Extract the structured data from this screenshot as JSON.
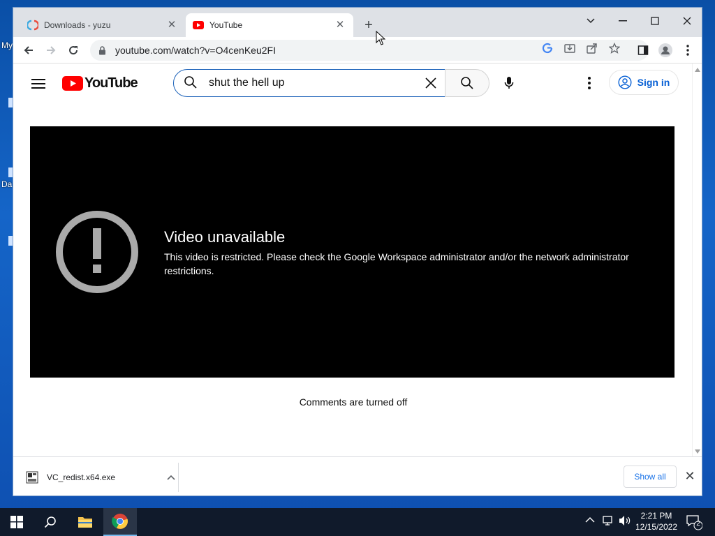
{
  "desktop": {
    "fragment_top": "My",
    "fragment_mid": "Da"
  },
  "tabs": [
    {
      "title": "Downloads - yuzu",
      "favicon": "yuzu-logo-icon",
      "active": false
    },
    {
      "title": "YouTube",
      "favicon": "youtube-icon",
      "active": true
    }
  ],
  "tab_close_glyph": "✕",
  "new_tab_glyph": "+",
  "address_bar": {
    "url": "youtube.com/watch?v=O4cenKeu2FI"
  },
  "youtube": {
    "logo_text": "YouTube",
    "search_query": "shut the hell up",
    "sign_in_label": "Sign in",
    "error_title": "Video unavailable",
    "error_message": "This video is restricted. Please check the Google Workspace administrator and/or the network administrator restrictions.",
    "comments_status": "Comments are turned off"
  },
  "downloads_bar": {
    "file_name": "VC_redist.x64.exe",
    "show_all_label": "Show all",
    "close_glyph": "✕"
  },
  "taskbar": {
    "time": "2:21 PM",
    "date": "12/15/2022",
    "notification_count": "2"
  },
  "colors": {
    "youtube_red": "#ff0000",
    "link_blue": "#065fd4",
    "search_border": "#1c62b9",
    "player_bg": "#000000"
  }
}
